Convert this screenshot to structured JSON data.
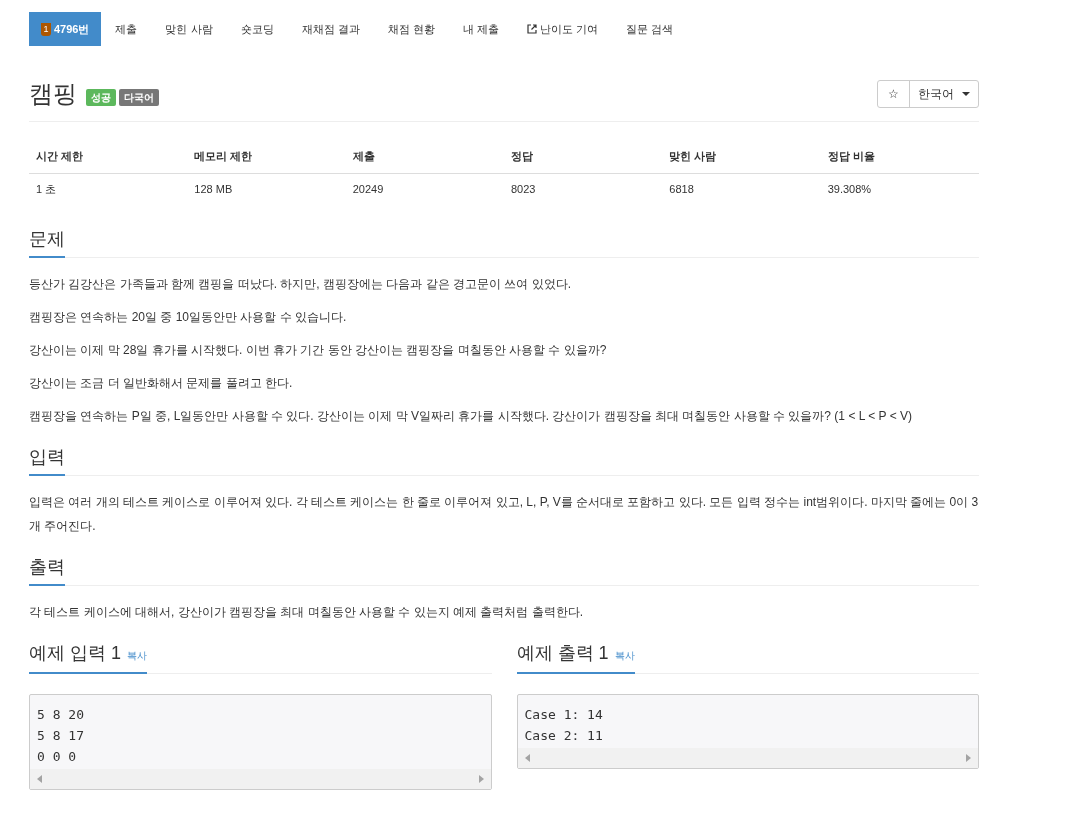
{
  "tabs": [
    {
      "label": "4796번",
      "kind": "problem",
      "badge": "1",
      "selected": true
    },
    {
      "label": "제출",
      "kind": "plain",
      "selected": false
    },
    {
      "label": "맞힌 사람",
      "kind": "plain",
      "selected": false
    },
    {
      "label": "숏코딩",
      "kind": "plain",
      "selected": false
    },
    {
      "label": "재채점 결과",
      "kind": "plain",
      "selected": false
    },
    {
      "label": "채점 현황",
      "kind": "plain",
      "selected": false
    },
    {
      "label": "내 제출",
      "kind": "plain",
      "selected": false
    },
    {
      "label": "난이도 기여",
      "kind": "external",
      "selected": false
    },
    {
      "label": "질문 검색",
      "kind": "plain",
      "selected": false
    }
  ],
  "title": "캠핑",
  "labels": [
    {
      "text": "성공",
      "color": "#5cb85c"
    },
    {
      "text": "다국어",
      "color": "#777777"
    }
  ],
  "language": {
    "star": "☆",
    "value": "한국어"
  },
  "stats": {
    "columns": [
      "시간 제한",
      "메모리 제한",
      "제출",
      "정답",
      "맞힌 사람",
      "정답 비율"
    ],
    "row": [
      "1 초",
      "128 MB",
      "20249",
      "8023",
      "6818",
      "39.308%"
    ]
  },
  "sections": [
    {
      "title": "문제",
      "paragraphs": [
        "등산가 김강산은 가족들과 함께 캠핑을 떠났다. 하지만, 캠핑장에는 다음과 같은 경고문이 쓰여 있었다.",
        "캠핑장은 연속하는 20일 중 10일동안만 사용할 수 있습니다.",
        "강산이는 이제 막 28일 휴가를 시작했다. 이번 휴가 기간 동안 강산이는 캠핑장을 며칠동안 사용할 수 있을까?",
        "강산이는 조금 더 일반화해서 문제를 풀려고 한다.",
        "캠핑장을 연속하는 P일 중, L일동안만 사용할 수 있다. 강산이는 이제 막 V일짜리 휴가를 시작했다. 강산이가 캠핑장을 최대 며칠동안 사용할 수 있을까? (1 < L < P < V)"
      ]
    },
    {
      "title": "입력",
      "paragraphs": [
        "입력은 여러 개의 테스트 케이스로 이루어져 있다. 각 테스트 케이스는 한 줄로 이루어져 있고, L, P, V를 순서대로 포함하고 있다. 모든 입력 정수는 int범위이다. 마지막 줄에는 0이 3개 주어진다."
      ]
    },
    {
      "title": "출력",
      "paragraphs": [
        "각 테스트 케이스에 대해서, 강산이가 캠핑장을 최대 며칠동안 사용할 수 있는지 예제 출력처럼 출력한다."
      ]
    }
  ],
  "samples": [
    {
      "title": "예제 입력 1",
      "copy": "복사",
      "lines": [
        "5 8 20",
        "5 8 17",
        "0 0 0"
      ]
    },
    {
      "title": "예제 출력 1",
      "copy": "복사",
      "lines": [
        "Case 1: 14",
        "Case 2: 11"
      ]
    }
  ]
}
